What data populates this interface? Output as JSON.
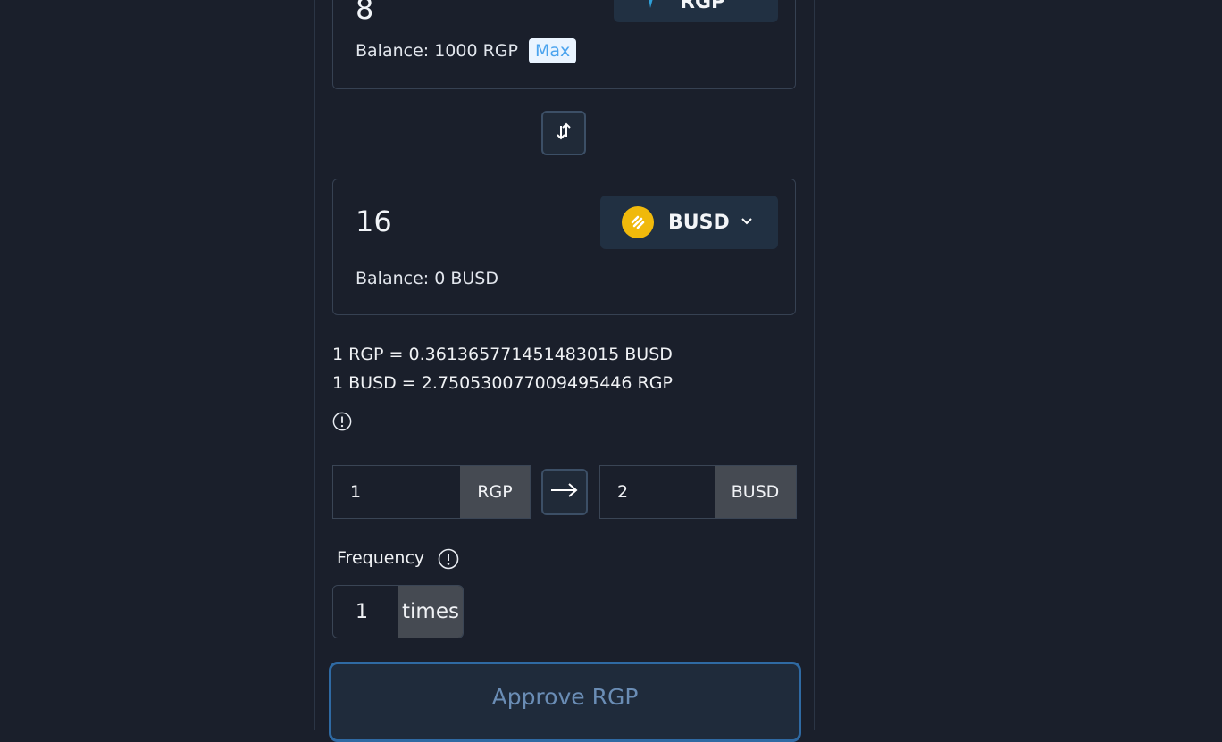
{
  "from_card": {
    "amount": "8",
    "token": "RGP",
    "balance": "Balance: 1000 RGP",
    "max_label": "Max"
  },
  "to_card": {
    "amount": "16",
    "token": "BUSD",
    "balance": "Balance: 0 BUSD"
  },
  "rates": {
    "line1": "1 RGP = 0.361365771451483015 BUSD",
    "line2": "1 BUSD = 2.750530077009495446 RGP"
  },
  "price_inputs": {
    "from_value": "1",
    "from_unit": "RGP",
    "to_value": "2",
    "to_unit": "BUSD"
  },
  "frequency": {
    "label": "Frequency",
    "value": "1",
    "unit": "times"
  },
  "approve_label": "Approve RGP",
  "colors": {
    "background": "#1a1f2b",
    "accent_border": "#2f6aa3",
    "busd_yellow": "#f0b90b",
    "max_text": "#4aa3ee"
  },
  "icons": {
    "swap": "swap-vertical-arrows-icon",
    "arrow": "arrow-right-icon",
    "info": "info-circle-icon",
    "chevron": "chevron-down-icon"
  }
}
